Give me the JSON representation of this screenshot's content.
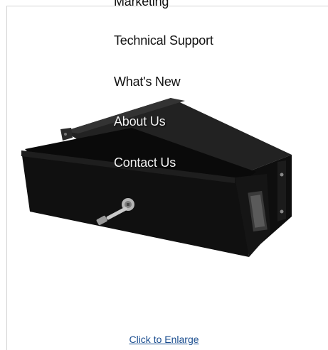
{
  "menu": {
    "items": [
      {
        "label": "Marketing"
      },
      {
        "label": "Technical Support"
      },
      {
        "label": "What's New"
      },
      {
        "label": "About Us"
      },
      {
        "label": "Contact Us"
      }
    ]
  },
  "product": {
    "link_label": "Click to Enlarge"
  }
}
